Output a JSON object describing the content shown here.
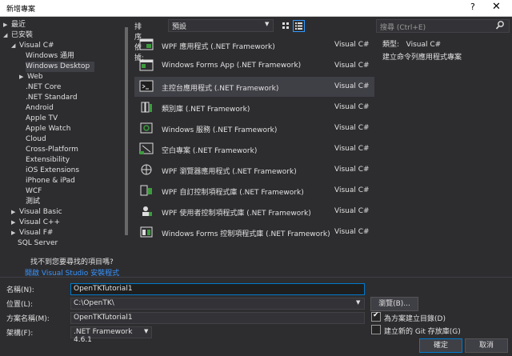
{
  "window": {
    "title": "新增專案",
    "help_label": "?",
    "close_label": "✕"
  },
  "tree": {
    "items": [
      {
        "label": "最近",
        "arrow": "▶",
        "indent": 0
      },
      {
        "label": "已安裝",
        "arrow": "◢",
        "indent": 0
      },
      {
        "label": "Visual C#",
        "arrow": "◢",
        "indent": 1
      },
      {
        "label": "Windows 通用",
        "arrow": "",
        "indent": 2
      },
      {
        "label": "Windows Desktop",
        "arrow": "",
        "indent": 2,
        "selected": true
      },
      {
        "label": "Web",
        "arrow": "▶",
        "indent": 2
      },
      {
        "label": ".NET Core",
        "arrow": "",
        "indent": 2
      },
      {
        "label": ".NET Standard",
        "arrow": "",
        "indent": 2
      },
      {
        "label": "Android",
        "arrow": "",
        "indent": 2
      },
      {
        "label": "Apple TV",
        "arrow": "",
        "indent": 2
      },
      {
        "label": "Apple Watch",
        "arrow": "",
        "indent": 2
      },
      {
        "label": "Cloud",
        "arrow": "",
        "indent": 2
      },
      {
        "label": "Cross-Platform",
        "arrow": "",
        "indent": 2
      },
      {
        "label": "Extensibility",
        "arrow": "",
        "indent": 2
      },
      {
        "label": "iOS Extensions",
        "arrow": "",
        "indent": 2
      },
      {
        "label": "iPhone & iPad",
        "arrow": "",
        "indent": 2
      },
      {
        "label": "WCF",
        "arrow": "",
        "indent": 2
      },
      {
        "label": "測試",
        "arrow": "",
        "indent": 2
      },
      {
        "label": "Visual Basic",
        "arrow": "▶",
        "indent": 1
      },
      {
        "label": "Visual C++",
        "arrow": "▶",
        "indent": 1
      },
      {
        "label": "Visual F#",
        "arrow": "▶",
        "indent": 1
      },
      {
        "label": "SQL Server",
        "arrow": "",
        "indent": 1
      }
    ],
    "not_found": "找不到您要尋找的項目嗎?",
    "open_installer": "開啟 Visual Studio 安裝程式"
  },
  "sort": {
    "label": "排序依據:",
    "value": "預設"
  },
  "templates": [
    {
      "name": "WPF 應用程式 (.NET Framework)",
      "lang": "Visual C#",
      "icon": "wpf-app-icon"
    },
    {
      "name": "Windows Forms App (.NET Framework)",
      "lang": "Visual C#",
      "icon": "winforms-app-icon"
    },
    {
      "name": "主控台應用程式 (.NET Framework)",
      "lang": "Visual C#",
      "icon": "console-app-icon",
      "selected": true
    },
    {
      "name": "類別庫 (.NET Framework)",
      "lang": "Visual C#",
      "icon": "class-library-icon"
    },
    {
      "name": "Windows 服務 (.NET Framework)",
      "lang": "Visual C#",
      "icon": "windows-service-icon"
    },
    {
      "name": "空白專案 (.NET Framework)",
      "lang": "Visual C#",
      "icon": "empty-project-icon"
    },
    {
      "name": "WPF 瀏覽器應用程式 (.NET Framework)",
      "lang": "Visual C#",
      "icon": "wpf-browser-app-icon"
    },
    {
      "name": "WPF 自訂控制項程式庫 (.NET Framework)",
      "lang": "Visual C#",
      "icon": "wpf-custom-control-icon"
    },
    {
      "name": "WPF 使用者控制項程式庫 (.NET Framework)",
      "lang": "Visual C#",
      "icon": "wpf-user-control-icon"
    },
    {
      "name": "Windows Forms 控制項程式庫 (.NET Framework)",
      "lang": "Visual C#",
      "icon": "winforms-control-library-icon"
    }
  ],
  "search": {
    "placeholder": "搜尋 (Ctrl+E)"
  },
  "info": {
    "type_line": "類型:   Visual C#",
    "description": "建立命令列應用程式專案"
  },
  "form": {
    "name_label": "名稱(N):",
    "name_value": "OpenTKTutorial1",
    "location_label": "位置(L):",
    "location_value": "C:\\OpenTK\\",
    "solution_label": "方案名稱(M):",
    "solution_value": "OpenTKTutorial1",
    "framework_label": "架構(F):",
    "framework_value": ".NET Framework 4.6.1",
    "browse_label": "瀏覽(B)...",
    "create_dir_label": "為方案建立目錄(D)",
    "create_dir_checked": true,
    "git_label": "建立新的 Git 存放庫(G)",
    "git_checked": false,
    "ok_label": "確定",
    "cancel_label": "取消"
  },
  "colors": {
    "bg": "#2d2d30",
    "selected": "#3f3f46",
    "accent": "#007acc",
    "link": "#3794ff"
  }
}
